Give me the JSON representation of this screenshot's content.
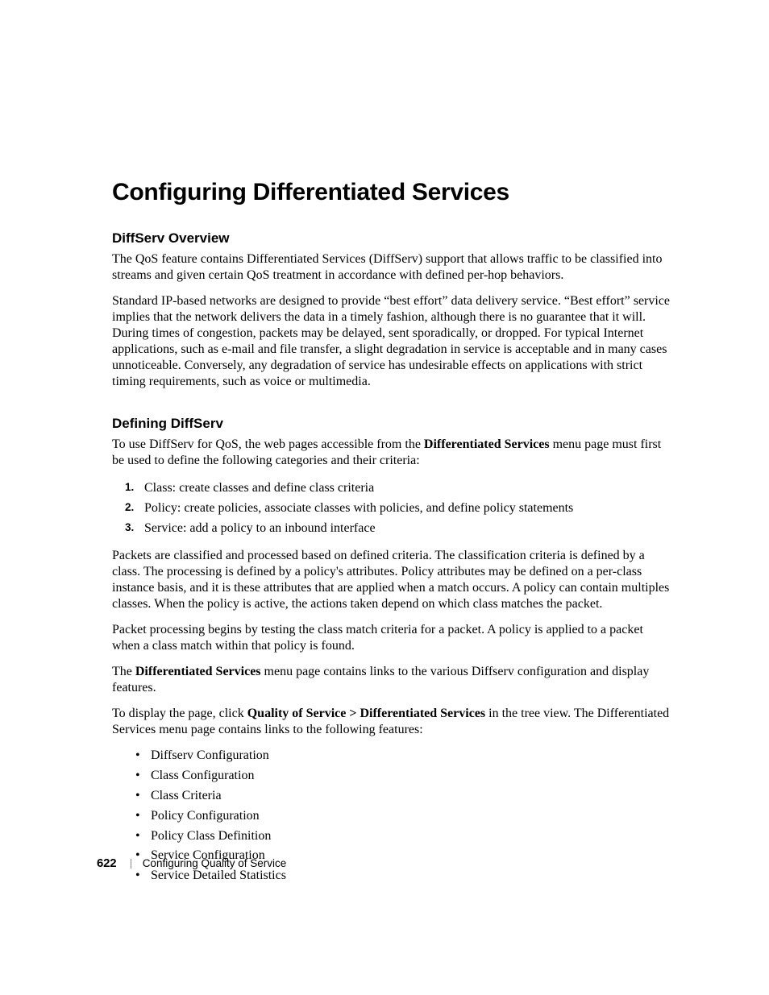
{
  "title": "Configuring Differentiated Services",
  "section1": {
    "heading": "DiffServ Overview",
    "p1": "The QoS feature contains Differentiated Services (DiffServ) support that allows traffic to be classified into streams and given certain QoS treatment in accordance with defined per-hop behaviors.",
    "p2": "Standard IP-based networks are designed to provide “best effort” data delivery service. “Best effort” service implies that the network delivers the data in a timely fashion, although there is no guarantee that it will. During times of congestion, packets may be delayed, sent sporadically, or dropped. For typical Internet applications, such as e-mail and file transfer, a slight degradation in service is acceptable and in many cases unnoticeable. Conversely, any degradation of service has undesirable effects on applications with strict timing requirements, such as voice or multimedia."
  },
  "section2": {
    "heading": "Defining DiffServ",
    "p1_a": "To use DiffServ for QoS, the web pages accessible from the ",
    "p1_bold": "Differentiated Services",
    "p1_b": " menu page must first be used to define the following categories and their criteria:",
    "ol": [
      "Class: create classes and define class criteria",
      "Policy: create policies, associate classes with policies, and define policy statements",
      "Service: add a policy to an inbound interface"
    ],
    "p2": "Packets are classified and processed based on defined criteria. The classification criteria is defined by a class. The processing is defined by a policy's attributes. Policy attributes may be defined on a per-class instance basis, and it is these attributes that are applied when a match occurs. A policy can contain multiples classes. When the policy is active, the actions taken depend on which class matches the packet.",
    "p3": "Packet processing begins by testing the class match criteria for a packet. A policy is applied to a packet when a class match within that policy is found.",
    "p4_a": "The ",
    "p4_bold": "Differentiated Services",
    "p4_b": " menu page contains links to the various Diffserv configuration and display features.",
    "p5_a": "To display the page, click ",
    "p5_bold": "Quality of Service > Differentiated Services",
    "p5_b": " in the tree view. The Differentiated Services menu page contains links to the following features:",
    "ul": [
      "Diffserv Configuration",
      "Class Configuration",
      "Class Criteria",
      "Policy Configuration",
      "Policy Class Definition",
      "Service Configuration",
      "Service Detailed Statistics"
    ]
  },
  "footer": {
    "page": "622",
    "book": "Configuring Quality of Service"
  }
}
